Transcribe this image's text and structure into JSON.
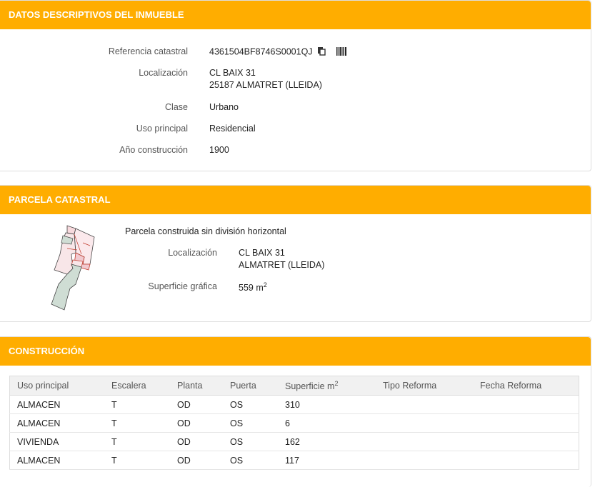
{
  "datos": {
    "title": "DATOS DESCRIPTIVOS DEL INMUEBLE",
    "ref_label": "Referencia catastral",
    "ref_value": "4361504BF8746S0001QJ",
    "loc_label": "Localización",
    "loc_line1": "CL BAIX 31",
    "loc_line2": "25187 ALMATRET (LLEIDA)",
    "clase_label": "Clase",
    "clase_value": "Urbano",
    "uso_label": "Uso principal",
    "uso_value": "Residencial",
    "anio_label": "Año construcción",
    "anio_value": "1900"
  },
  "parcela": {
    "title": "PARCELA CATASTRAL",
    "desc": "Parcela construida sin división horizontal",
    "loc_label": "Localización",
    "loc_line1": "CL BAIX 31",
    "loc_line2": "ALMATRET (LLEIDA)",
    "sup_label": "Superficie gráfica",
    "sup_value": "559 m",
    "sup_sup": "2"
  },
  "construccion": {
    "title": "CONSTRUCCIÓN",
    "headers": [
      "Uso principal",
      "Escalera",
      "Planta",
      "Puerta",
      "Superficie m",
      "Tipo Reforma",
      "Fecha Reforma"
    ],
    "sup_sup": "2",
    "rows": [
      [
        "ALMACEN",
        "T",
        "OD",
        "OS",
        "310",
        "",
        ""
      ],
      [
        "ALMACEN",
        "T",
        "OD",
        "OS",
        "6",
        "",
        ""
      ],
      [
        "VIVIENDA",
        "T",
        "OD",
        "OS",
        "162",
        "",
        ""
      ],
      [
        "ALMACEN",
        "T",
        "OD",
        "OS",
        "117",
        "",
        ""
      ]
    ]
  },
  "icons": {
    "copy": "copy-icon",
    "barcode": "barcode-icon"
  }
}
